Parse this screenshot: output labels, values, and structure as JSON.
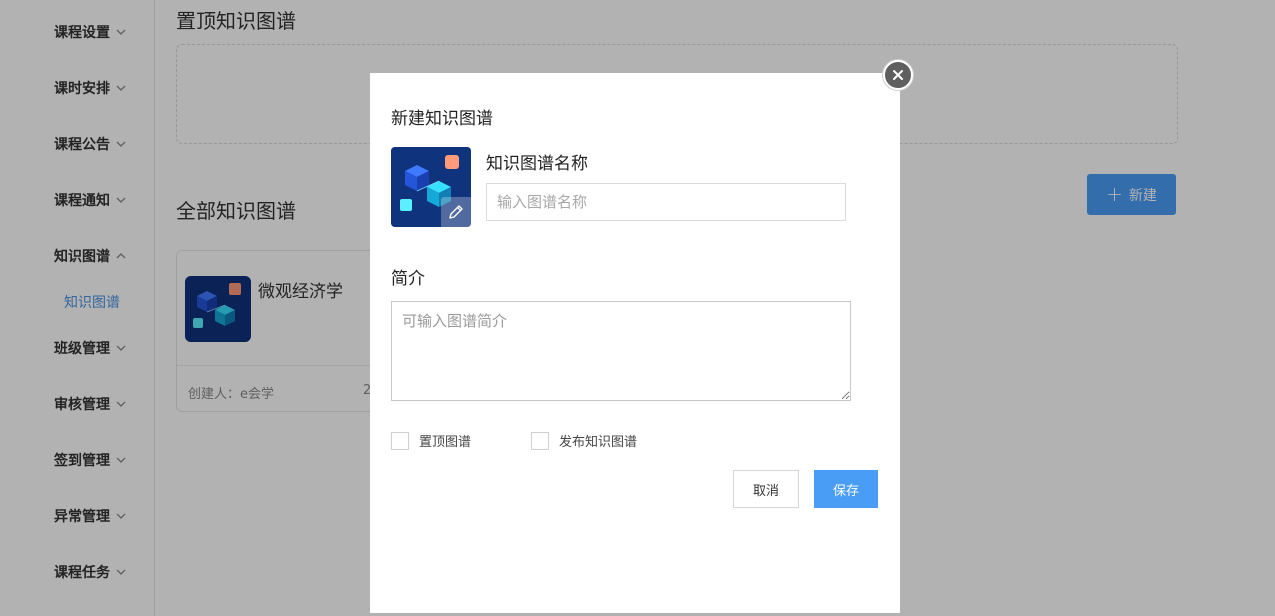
{
  "sidebar": {
    "items": [
      {
        "label": "课程设置",
        "expanded": false
      },
      {
        "label": "课时安排",
        "expanded": false
      },
      {
        "label": "课程公告",
        "expanded": false
      },
      {
        "label": "课程通知",
        "expanded": false
      },
      {
        "label": "知识图谱",
        "expanded": true
      },
      {
        "label": "班级管理",
        "expanded": false
      },
      {
        "label": "审核管理",
        "expanded": false
      },
      {
        "label": "签到管理",
        "expanded": false
      },
      {
        "label": "异常管理",
        "expanded": false
      },
      {
        "label": "课程任务",
        "expanded": false
      }
    ],
    "active_sub_item": "知识图谱"
  },
  "main": {
    "pinned_title": "置顶知识图谱",
    "all_title": "全部知识图谱",
    "new_button_icon": "plus-icon",
    "new_button_label": "新建",
    "cards": [
      {
        "name": "微观经济学",
        "creator": "创建人：e会学",
        "date_fragment": "2"
      }
    ]
  },
  "modal": {
    "title": "新建知识图谱",
    "name_label": "知识图谱名称",
    "name_placeholder": "输入图谱名称",
    "name_value": "",
    "intro_label": "简介",
    "intro_placeholder": "可输入图谱简介",
    "intro_value": "",
    "pin_label": "置顶图谱",
    "pin_checked": false,
    "publish_label": "发布知识图谱",
    "publish_checked": false,
    "cancel_label": "取消",
    "save_label": "保存",
    "close_icon": "close-icon",
    "edit_icon": "pencil-icon"
  },
  "colors": {
    "primary": "#4a9df5",
    "active_link": "#4a90e2",
    "overlay": "rgba(0,0,0,0.30)"
  }
}
